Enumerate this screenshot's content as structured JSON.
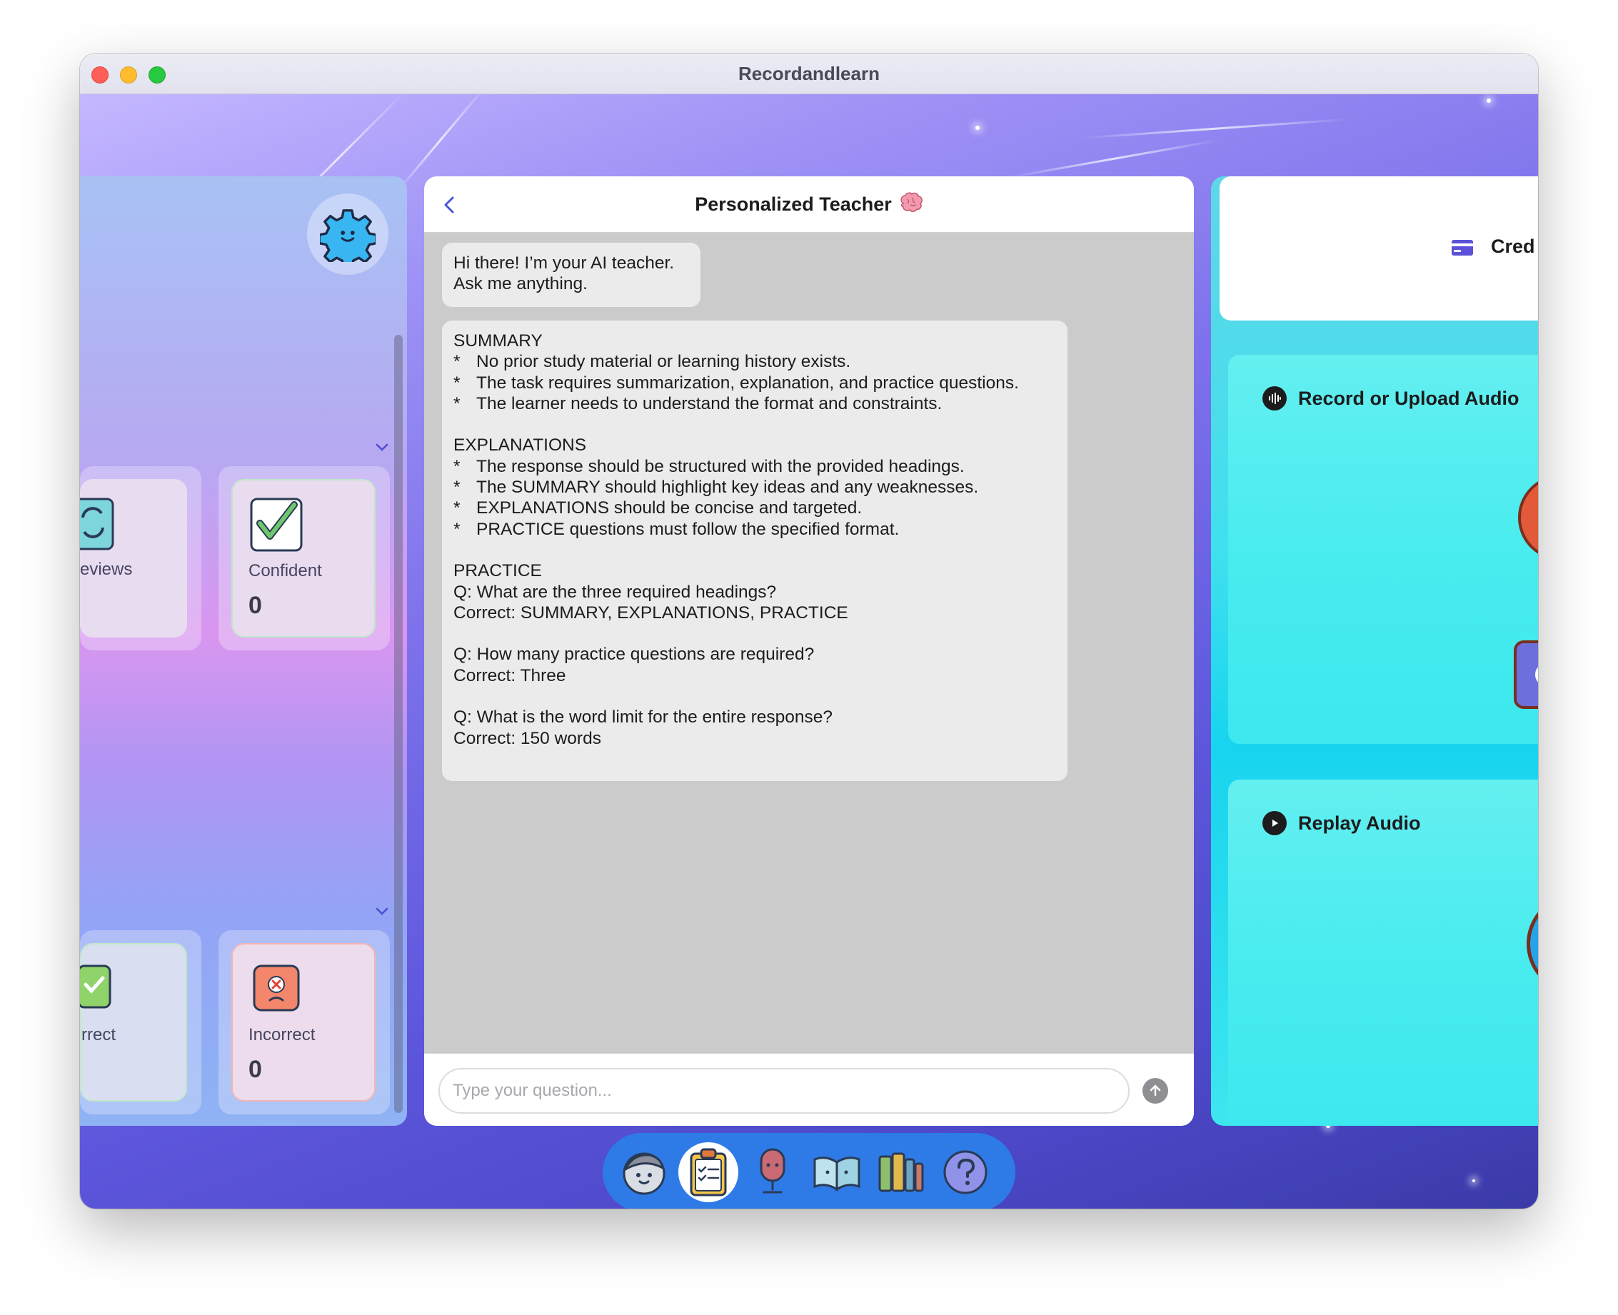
{
  "window": {
    "title": "Recordandlearn"
  },
  "left_panel": {
    "cards": [
      {
        "label": "Reviews",
        "visible_label": "eviews",
        "icon": "refresh-icon"
      },
      {
        "label": "Confident",
        "value": "0",
        "icon": "checkmark-icon"
      },
      {
        "label": "Correct",
        "visible_label": "rrect",
        "icon": "smiley-check-icon"
      },
      {
        "label": "Incorrect",
        "value": "0",
        "icon": "sad-x-icon"
      }
    ]
  },
  "chat": {
    "title": "Personalized Teacher",
    "title_emoji": "🧠",
    "greeting": [
      "Hi there! I’m your AI teacher.",
      "Ask me anything."
    ],
    "response": {
      "summary_heading": "SUMMARY",
      "summary_bullets": [
        "No prior study material or learning history exists.",
        "The task requires summarization, explanation, and practice questions.",
        "The learner needs to understand the format and constraints."
      ],
      "explanations_heading": "EXPLANATIONS",
      "explanations_bullets": [
        "The response should be structured with the provided headings.",
        "The SUMMARY should highlight key ideas and any weaknesses.",
        "EXPLANATIONS should be concise and targeted.",
        "PRACTICE questions must follow the specified format."
      ],
      "practice_heading": "PRACTICE",
      "practice": [
        {
          "q": "Q: What are the three required headings?",
          "a": "Correct: SUMMARY, EXPLANATIONS, PRACTICE"
        },
        {
          "q": "Q: How many practice questions are required?",
          "a": "Correct: Three"
        },
        {
          "q": "Q: What is the word limit for the entire response?",
          "a": "Correct: 150 words"
        }
      ]
    },
    "bullet_mark": "*",
    "input_placeholder": "Type your question..."
  },
  "right_panel": {
    "credits_label": "Cred",
    "record_label": "Record or Upload Audio",
    "replay_label": "Replay Audio"
  },
  "dock": {
    "items": [
      "avatar-icon",
      "clipboard-icon",
      "microphone-icon",
      "open-book-icon",
      "books-icon",
      "help-icon"
    ],
    "active_index": 1
  },
  "colors": {
    "accent": "#2e7be8",
    "chat_bg": "#cbcbcb",
    "bubble_bg": "#ebebeb"
  }
}
